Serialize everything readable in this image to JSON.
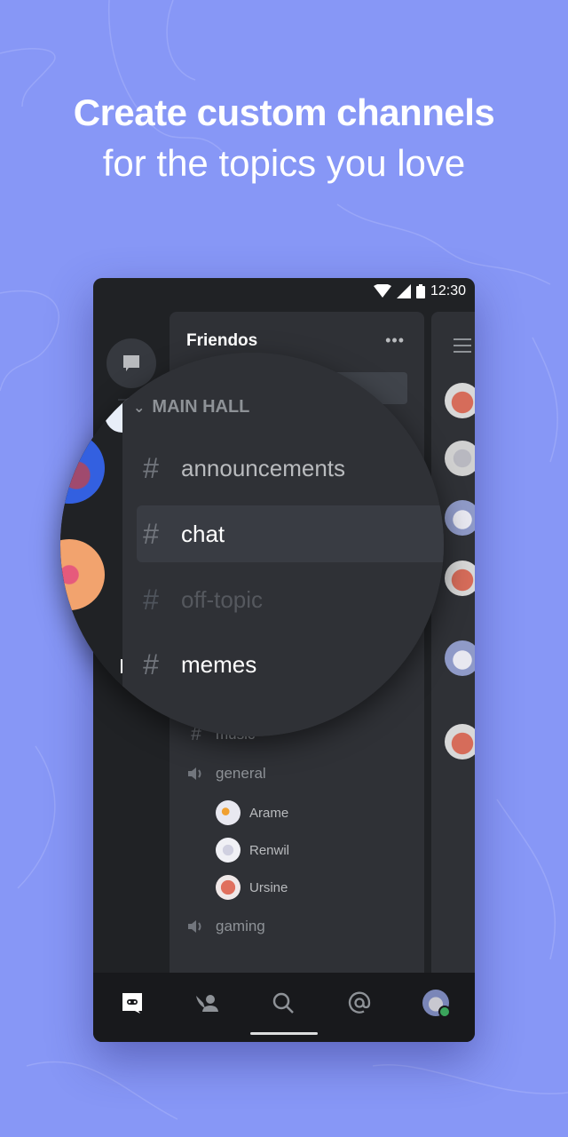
{
  "headline": {
    "title": "Create custom channels",
    "subtitle": "for the topics you love"
  },
  "status_bar": {
    "time": "12:30",
    "icons": [
      "wifi-icon",
      "signal-icon",
      "battery-icon"
    ]
  },
  "server": {
    "name": "Friendos",
    "more_label": "•••"
  },
  "category": {
    "name": "MAIN HALL",
    "chevron": "⌄"
  },
  "magnified_channels": [
    {
      "name": "announcements",
      "state": "normal"
    },
    {
      "name": "chat",
      "state": "selected"
    },
    {
      "name": "off-topic",
      "state": "muted"
    },
    {
      "name": "memes",
      "state": "unread"
    }
  ],
  "channels_below": [
    {
      "type": "text",
      "name": "music"
    },
    {
      "type": "voice",
      "name": "general",
      "users": [
        "Arame",
        "Renwil",
        "Ursine"
      ]
    },
    {
      "type": "voice",
      "name": "gaming",
      "users": []
    }
  ],
  "hash_symbol": "#",
  "bottom_nav": [
    {
      "icon": "discord-home-icon",
      "label": "Home",
      "active": true
    },
    {
      "icon": "friends-icon",
      "label": "Friends",
      "active": false
    },
    {
      "icon": "search-icon",
      "label": "Search",
      "active": false
    },
    {
      "icon": "mentions-icon",
      "label": "Mentions",
      "active": false
    },
    {
      "icon": "profile-avatar",
      "label": "Profile",
      "active": false,
      "status": "online"
    }
  ],
  "colors": {
    "background": "#8797f6",
    "status_online": "#3ba55c"
  }
}
